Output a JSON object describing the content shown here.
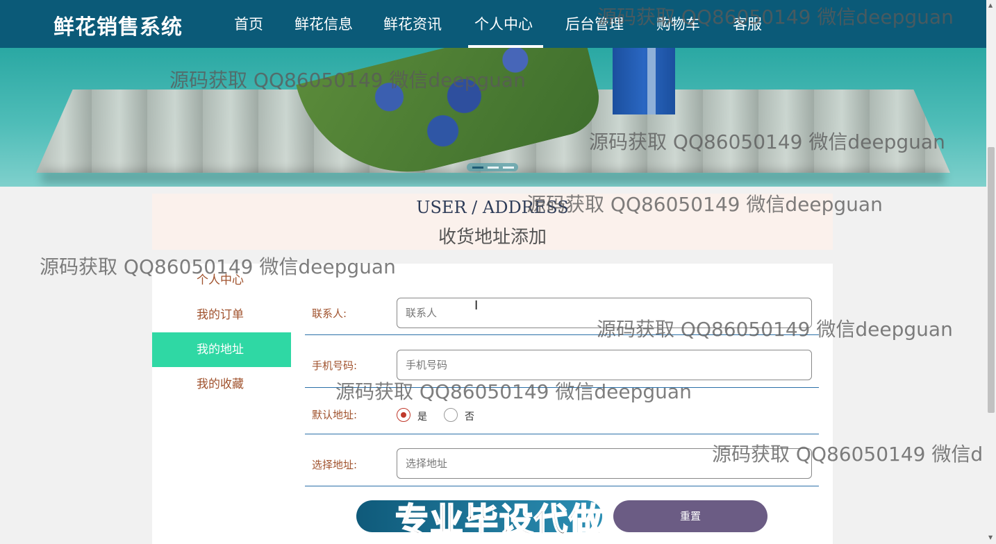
{
  "brand": "鲜花销售系统",
  "nav": {
    "items": [
      "首页",
      "鲜花信息",
      "鲜花资讯",
      "个人中心",
      "后台管理",
      "购物车",
      "客服"
    ],
    "active": "个人中心"
  },
  "section": {
    "title_en": "USER / ADDRESS",
    "title_cn": "收货地址添加"
  },
  "sidebar": {
    "items": [
      {
        "label": "个人中心",
        "active": false
      },
      {
        "label": "我的订单",
        "active": false
      },
      {
        "label": "我的地址",
        "active": true
      },
      {
        "label": "我的收藏",
        "active": false
      }
    ]
  },
  "form": {
    "contact": {
      "label": "联系人:",
      "placeholder": "联系人",
      "value": ""
    },
    "phone": {
      "label": "手机号码:",
      "placeholder": "手机号码",
      "value": ""
    },
    "default": {
      "label": "默认地址:",
      "options": [
        "是",
        "否"
      ],
      "selected": "是"
    },
    "address": {
      "label": "选择地址:",
      "placeholder": "选择地址",
      "value": ""
    },
    "reset_label": "重置"
  },
  "overlay": {
    "cover_text": "专业毕设代做",
    "watermark": "源码获取 QQ86050149 微信deepguan",
    "watermark_cut": "源码获取 QQ86050149 微信d"
  },
  "colors": {
    "nav_bg": "#0b5a78",
    "sidebar_active": "#2fd8a4",
    "label_color": "#a0522d",
    "submit_button": "#1f7a9f",
    "reset_button": "#6b5c84"
  }
}
